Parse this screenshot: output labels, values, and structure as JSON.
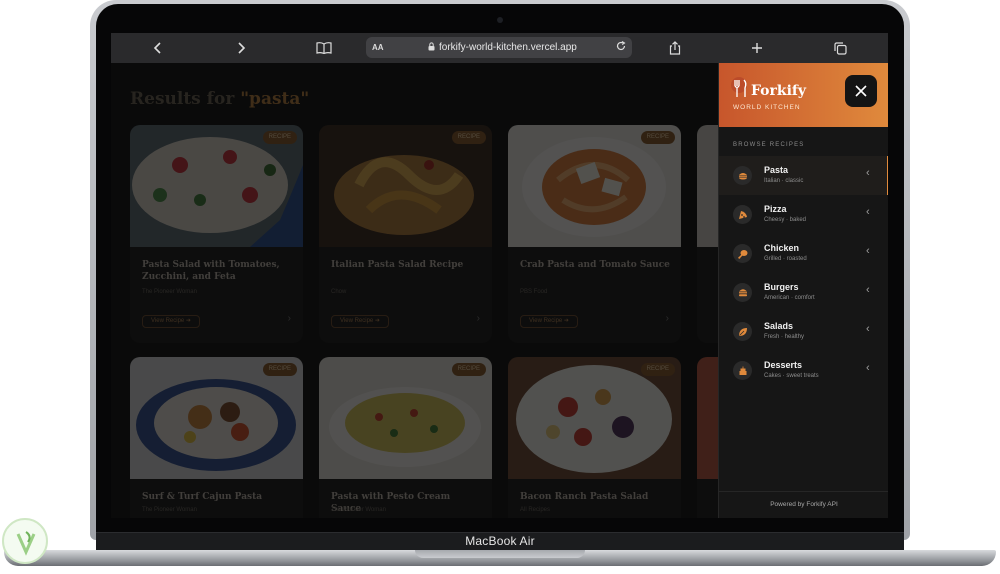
{
  "device": {
    "label": "MacBook Air"
  },
  "browser": {
    "aa_label": "AA",
    "url": "forkify-world-kitchen.vercel.app",
    "icons": [
      "chevron-left-icon",
      "chevron-right-icon",
      "book-icon",
      "lock-icon",
      "reload-icon",
      "share-icon",
      "plus-icon",
      "tabs-icon"
    ]
  },
  "page": {
    "results_prefix": "Results for ",
    "results_query": "\"pasta\"",
    "cards": [
      {
        "title": "Pasta Salad with Tomatoes, Zucchini, and Feta",
        "publisher": "The Pioneer Woman",
        "badge": "RECIPE",
        "button": "View Recipe ➜"
      },
      {
        "title": "Italian Pasta Salad Recipe",
        "publisher": "Chow",
        "badge": "RECIPE",
        "button": "View Recipe ➜"
      },
      {
        "title": "Crab Pasta and Tomato Sauce",
        "publisher": "PBS Food",
        "badge": "RECIPE",
        "button": "View Recipe ➜"
      },
      {
        "title": "Surf & Turf Cajun Pasta",
        "publisher": "The Pioneer Woman",
        "badge": "RECIPE",
        "button": ""
      },
      {
        "title": "Pasta with Pesto Cream Sauce",
        "publisher": "The Pioneer Woman",
        "badge": "RECIPE",
        "button": ""
      },
      {
        "title": "Bacon Ranch Pasta Salad",
        "publisher": "All Recipes",
        "badge": "RECIPE",
        "button": ""
      }
    ]
  },
  "sidebar": {
    "brand": "Forkify",
    "tagline": "WORLD KITCHEN",
    "section_label": "BROWSE RECIPES",
    "active_index": 0,
    "items": [
      {
        "label": "Pasta",
        "sub": "Italian · classic",
        "icon": "pasta-icon"
      },
      {
        "label": "Pizza",
        "sub": "Cheesy · baked",
        "icon": "pizza-icon"
      },
      {
        "label": "Chicken",
        "sub": "Grilled · roasted",
        "icon": "chicken-icon"
      },
      {
        "label": "Burgers",
        "sub": "American · comfort",
        "icon": "burger-icon"
      },
      {
        "label": "Salads",
        "sub": "Fresh · healthy",
        "icon": "leaf-icon"
      },
      {
        "label": "Desserts",
        "sub": "Cakes · sweet treats",
        "icon": "cake-icon"
      }
    ],
    "footer": "Powered by Forkify API"
  },
  "colors": {
    "accent": "#e08a3c",
    "header_start": "#c7562c",
    "background": "#121212"
  }
}
